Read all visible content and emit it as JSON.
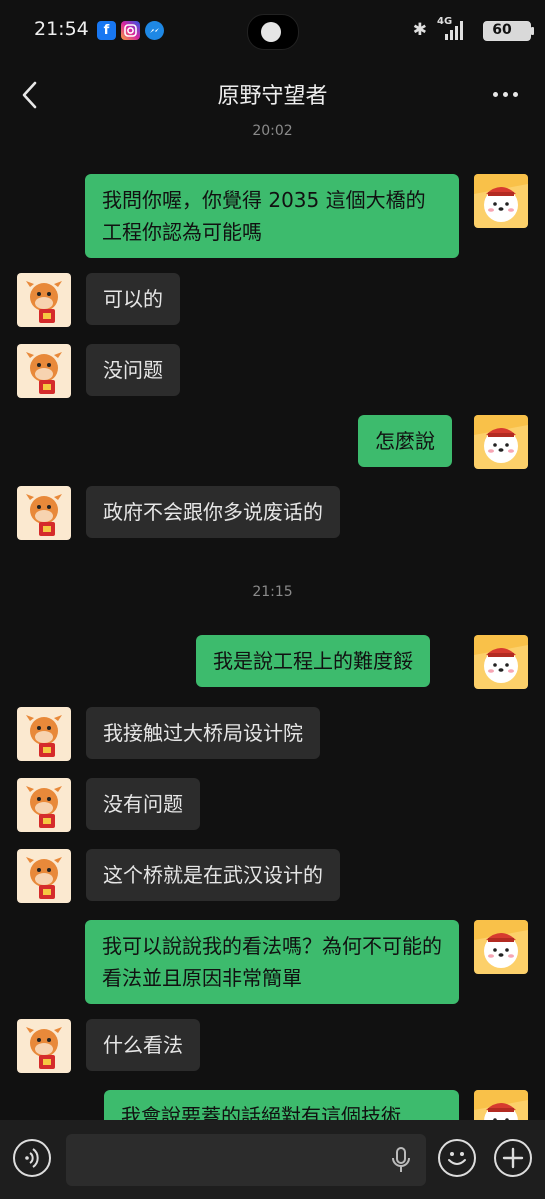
{
  "status_bar": {
    "time": "21:54",
    "apps": [
      "facebook-icon",
      "instagram-icon",
      "messenger-icon"
    ],
    "network": "4G",
    "battery": "60"
  },
  "header": {
    "title": "原野守望者"
  },
  "messages": [
    {
      "type": "time",
      "text": "20:02"
    },
    {
      "type": "msg",
      "side": "out",
      "text": "我問你喔，你覺得 2035 這個大橋的工程你認為可能嗎"
    },
    {
      "type": "msg",
      "side": "in",
      "text": "可以的"
    },
    {
      "type": "msg",
      "side": "in",
      "text": "没问题"
    },
    {
      "type": "msg",
      "side": "out",
      "text": "怎麼說"
    },
    {
      "type": "msg",
      "side": "in",
      "text": "政府不会跟你多说废话的"
    },
    {
      "type": "time",
      "text": "21:15"
    },
    {
      "type": "msg",
      "side": "out",
      "text": "我是說工程上的難度餒"
    },
    {
      "type": "msg",
      "side": "in",
      "text": "我接触过大桥局设计院"
    },
    {
      "type": "msg",
      "side": "in",
      "text": "没有问题"
    },
    {
      "type": "msg",
      "side": "in",
      "text": "这个桥就是在武汉设计的"
    },
    {
      "type": "msg",
      "side": "out",
      "text": "我可以說說我的看法嗎？為何不可能的看法並且原因非常簡單"
    },
    {
      "type": "msg",
      "side": "in",
      "text": "什么看法"
    },
    {
      "type": "msg",
      "side": "out",
      "text": "我會說要蓋的話絕對有這個技術"
    }
  ],
  "colors": {
    "background": "#111111",
    "incoming_bubble": "#2c2c2c",
    "outgoing_bubble": "#3dbb6d"
  }
}
